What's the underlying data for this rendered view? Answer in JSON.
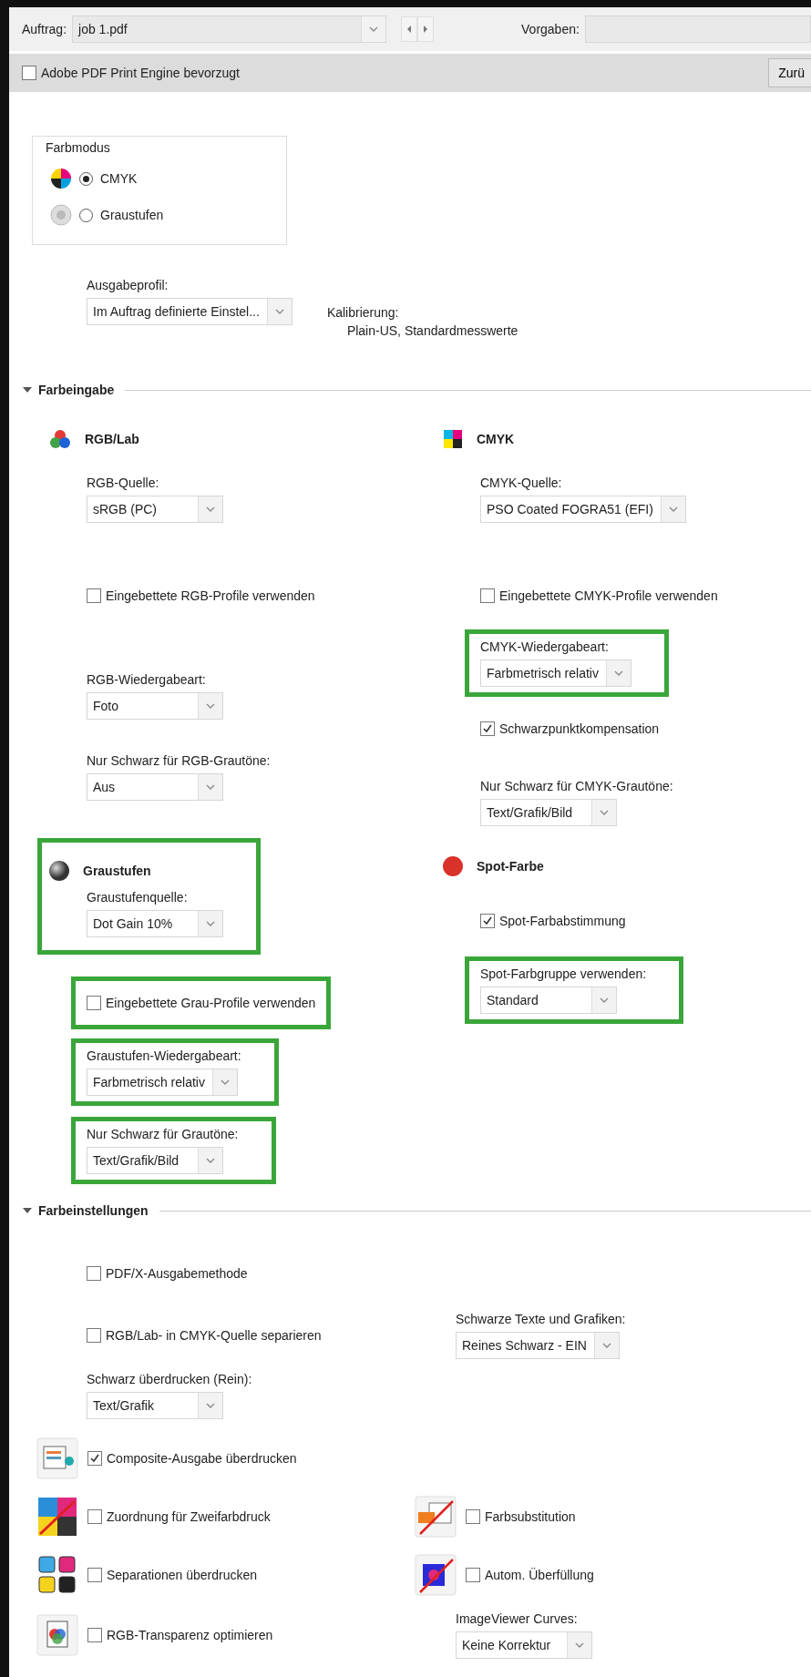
{
  "toolbar": {
    "job_label": "Auftrag:",
    "job_value": "job 1.pdf",
    "presets_label": "Vorgaben:"
  },
  "options_bar": {
    "checkbox": {
      "label": "Adobe PDF Print Engine bevorzugt",
      "checked": false
    },
    "button": "Zurü"
  },
  "color_mode": {
    "title": "Farbmodus",
    "options": [
      {
        "label": "CMYK",
        "selected": true
      },
      {
        "label": "Graustufen",
        "selected": false
      }
    ]
  },
  "output_profile": {
    "label": "Ausgabeprofil:",
    "value": "Im Auftrag definierte Einstel...",
    "calibration_label": "Kalibrierung:",
    "calibration_value": "Plain-US, Standardmesswerte"
  },
  "color_input": {
    "title": "Farbeingabe",
    "expanded": true,
    "columns": [
      [
        {
          "kind": "heading",
          "text": "RGB/Lab"
        },
        {
          "kind": "select",
          "label": "RGB-Quelle:",
          "value": "sRGB (PC)",
          "highlighted": false
        },
        {
          "kind": "checkbox",
          "label": "Eingebettete RGB-Profile verwenden",
          "checked": false,
          "highlighted": false
        },
        {
          "kind": "select",
          "label": "RGB-Wiedergabeart:",
          "value": "Foto",
          "highlighted": false
        },
        {
          "kind": "select",
          "label": "Nur Schwarz für RGB-Grautöne:",
          "value": "Aus",
          "highlighted": false
        },
        {
          "kind": "group",
          "highlighted": true,
          "items": [
            {
              "kind": "heading",
              "text": "Graustufen"
            },
            {
              "kind": "select",
              "label": "Graustufenquelle:",
              "value": "Dot Gain 10%"
            }
          ]
        },
        {
          "kind": "checkbox",
          "label": "Eingebettete Grau-Profile verwenden",
          "checked": false,
          "highlighted": true
        },
        {
          "kind": "select",
          "label": "Graustufen-Wiedergabeart:",
          "value": "Farbmetrisch relativ",
          "highlighted": true
        },
        {
          "kind": "select",
          "label": "Nur Schwarz für Grautöne:",
          "value": "Text/Grafik/Bild",
          "highlighted": true
        }
      ],
      [
        {
          "kind": "heading",
          "text": "CMYK"
        },
        {
          "kind": "select",
          "label": "CMYK-Quelle:",
          "value": "PSO Coated FOGRA51 (EFI)",
          "highlighted": false
        },
        {
          "kind": "checkbox",
          "label": "Eingebettete CMYK-Profile verwenden",
          "checked": false,
          "highlighted": false
        },
        {
          "kind": "select",
          "label": "CMYK-Wiedergabeart:",
          "value": "Farbmetrisch relativ",
          "highlighted": true
        },
        {
          "kind": "checkbox",
          "label": "Schwarzpunktkompensation",
          "checked": true,
          "highlighted": false
        },
        {
          "kind": "select",
          "label": "Nur Schwarz für CMYK-Grautöne:",
          "value": "Text/Grafik/Bild",
          "highlighted": false
        },
        {
          "kind": "heading",
          "text": "Spot-Farbe"
        },
        {
          "kind": "checkbox",
          "label": "Spot-Farbabstimmung",
          "checked": true,
          "highlighted": false
        },
        {
          "kind": "select",
          "label": "Spot-Farbgruppe verwenden:",
          "value": "Standard",
          "highlighted": true
        }
      ]
    ]
  },
  "color_settings": {
    "title": "Farbeinstellungen",
    "expanded": true,
    "rows": [
      {
        "left": {
          "kind": "checkbox",
          "label": "PDF/X-Ausgabemethode",
          "checked": false
        }
      },
      {
        "left": {
          "kind": "checkbox",
          "label": "RGB/Lab- in CMYK-Quelle separieren",
          "checked": false
        },
        "right": {
          "kind": "select",
          "label": "Schwarze Texte und Grafiken:",
          "value": "Reines Schwarz - EIN"
        }
      },
      {
        "left": {
          "kind": "select",
          "label": "Schwarz überdrucken (Rein):",
          "value": "Text/Grafik"
        }
      },
      {
        "left": {
          "kind": "icon-checkbox",
          "label": "Composite-Ausgabe überdrucken",
          "checked": true
        }
      },
      {
        "left": {
          "kind": "icon-checkbox",
          "label": "Zuordnung für Zweifarbdruck",
          "checked": false
        },
        "right": {
          "kind": "icon-checkbox",
          "label": "Farbsubstitution",
          "checked": false
        }
      },
      {
        "left": {
          "kind": "icon-checkbox",
          "label": "Separationen überdrucken",
          "checked": false
        },
        "right": {
          "kind": "icon-checkbox",
          "label": "Autom. Überfüllung",
          "checked": false
        }
      },
      {
        "left": {
          "kind": "icon-checkbox",
          "label": "RGB-Transparenz optimieren",
          "checked": false
        },
        "right": {
          "kind": "select",
          "label": "ImageViewer Curves:",
          "value": "Keine Korrektur"
        }
      }
    ]
  }
}
